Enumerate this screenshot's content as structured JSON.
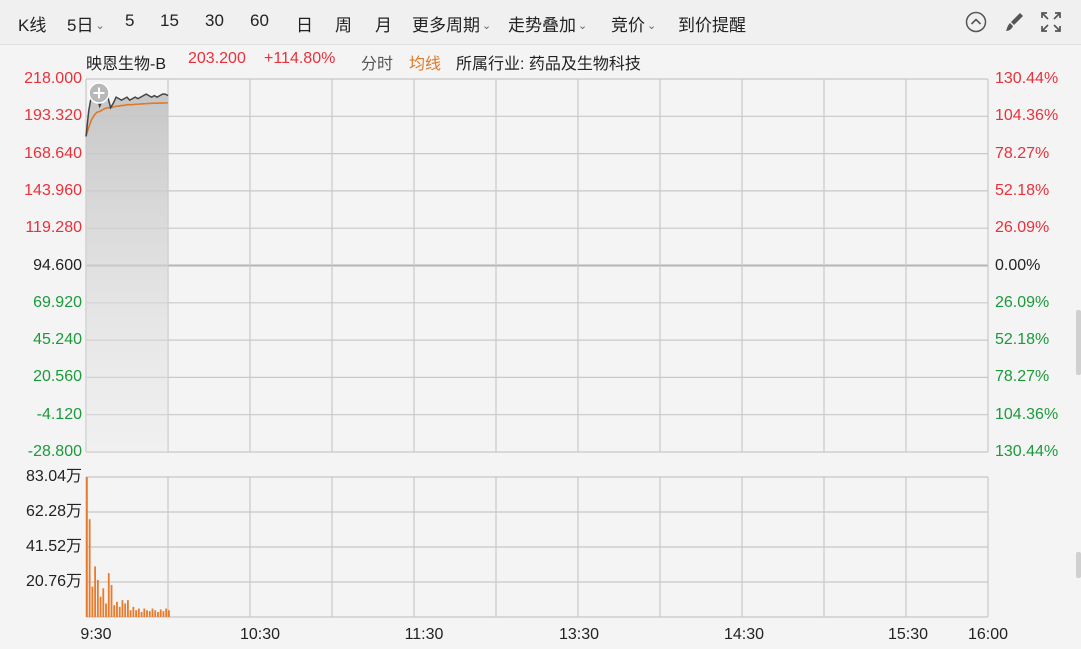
{
  "toolbar": {
    "kline": "K线",
    "days5": "5日",
    "m5": "5",
    "m15": "15",
    "m30": "30",
    "m60": "60",
    "day": "日",
    "week": "周",
    "month": "月",
    "more_periods": "更多周期",
    "trend_overlay": "走势叠加",
    "auction": "竞价",
    "price_alert": "到价提醒",
    "icons": [
      "collapse-up-icon",
      "brush-icon",
      "fullscreen-icon"
    ]
  },
  "stock": {
    "name": "映恩生物-B",
    "price": "203.200",
    "change": "+114.80%",
    "intraday_label": "分时",
    "avg_line_label": "均线",
    "industry": "所属行业: 药品及生物科技"
  },
  "colors": {
    "up": "#e8313a",
    "down": "#1a9a3b",
    "price_line": "#444444",
    "avg_line": "#e07828",
    "volume": "#e87a2a",
    "grid": "#c8c8c8"
  },
  "chart_data": {
    "type": "line",
    "price_axis": {
      "left_labels": [
        "218.000",
        "193.320",
        "168.640",
        "143.960",
        "119.280",
        "94.600",
        "69.920",
        "45.240",
        "20.560",
        "-4.120",
        "-28.800"
      ],
      "right_labels": [
        "130.44%",
        "104.36%",
        "78.27%",
        "52.18%",
        "26.09%",
        "0.00%",
        "26.09%",
        "52.18%",
        "78.27%",
        "104.36%",
        "130.44%"
      ],
      "ylim": [
        -28.8,
        218.0
      ],
      "reference": 94.6
    },
    "volume_axis": {
      "labels": [
        "83.04万",
        "62.28万",
        "41.52万",
        "20.76万"
      ],
      "ylim": [
        0,
        83.04
      ]
    },
    "time_labels": [
      "9:30",
      "10:30",
      "11:30",
      "13:30",
      "14:30",
      "15:30",
      "16:00"
    ],
    "price_series": [
      {
        "t": 0,
        "v": 180
      },
      {
        "t": 1,
        "v": 197
      },
      {
        "t": 2,
        "v": 207
      },
      {
        "t": 3,
        "v": 208
      },
      {
        "t": 4,
        "v": 206
      },
      {
        "t": 5,
        "v": 200
      },
      {
        "t": 6,
        "v": 204
      },
      {
        "t": 7,
        "v": 207
      },
      {
        "t": 8,
        "v": 206
      },
      {
        "t": 9,
        "v": 199
      },
      {
        "t": 10,
        "v": 202
      },
      {
        "t": 11,
        "v": 206
      },
      {
        "t": 12,
        "v": 205
      },
      {
        "t": 13,
        "v": 204
      },
      {
        "t": 14,
        "v": 205
      },
      {
        "t": 15,
        "v": 206
      },
      {
        "t": 16,
        "v": 204
      },
      {
        "t": 17,
        "v": 205
      },
      {
        "t": 18,
        "v": 206
      },
      {
        "t": 19,
        "v": 205
      },
      {
        "t": 20,
        "v": 206
      },
      {
        "t": 21,
        "v": 207
      },
      {
        "t": 22,
        "v": 208
      },
      {
        "t": 23,
        "v": 207
      },
      {
        "t": 24,
        "v": 206
      },
      {
        "t": 25,
        "v": 207
      },
      {
        "t": 26,
        "v": 206
      },
      {
        "t": 27,
        "v": 207
      },
      {
        "t": 28,
        "v": 208
      },
      {
        "t": 29,
        "v": 208
      },
      {
        "t": 30,
        "v": 207
      }
    ],
    "avg_series": [
      {
        "t": 0,
        "v": 180
      },
      {
        "t": 1,
        "v": 186
      },
      {
        "t": 2,
        "v": 191
      },
      {
        "t": 3,
        "v": 194
      },
      {
        "t": 4,
        "v": 196
      },
      {
        "t": 5,
        "v": 196.5
      },
      {
        "t": 6,
        "v": 197.5
      },
      {
        "t": 7,
        "v": 198.5
      },
      {
        "t": 8,
        "v": 199
      },
      {
        "t": 9,
        "v": 199
      },
      {
        "t": 10,
        "v": 199.5
      },
      {
        "t": 11,
        "v": 200
      },
      {
        "t": 12,
        "v": 200
      },
      {
        "t": 13,
        "v": 200.5
      },
      {
        "t": 14,
        "v": 200.5
      },
      {
        "t": 15,
        "v": 201
      },
      {
        "t": 16,
        "v": 201
      },
      {
        "t": 17,
        "v": 201
      },
      {
        "t": 18,
        "v": 201.3
      },
      {
        "t": 19,
        "v": 201.3
      },
      {
        "t": 20,
        "v": 201.5
      },
      {
        "t": 21,
        "v": 201.6
      },
      {
        "t": 22,
        "v": 201.7
      },
      {
        "t": 23,
        "v": 201.8
      },
      {
        "t": 24,
        "v": 201.9
      },
      {
        "t": 25,
        "v": 202
      },
      {
        "t": 26,
        "v": 202
      },
      {
        "t": 27,
        "v": 202.1
      },
      {
        "t": 28,
        "v": 202.1
      },
      {
        "t": 29,
        "v": 202.2
      },
      {
        "t": 30,
        "v": 202.2
      }
    ],
    "volume_series": [
      {
        "t": 0,
        "v": 83.0
      },
      {
        "t": 1,
        "v": 58.0
      },
      {
        "t": 2,
        "v": 18.0
      },
      {
        "t": 3,
        "v": 30.0
      },
      {
        "t": 4,
        "v": 22.0
      },
      {
        "t": 5,
        "v": 12.0
      },
      {
        "t": 6,
        "v": 17.0
      },
      {
        "t": 7,
        "v": 8.0
      },
      {
        "t": 8,
        "v": 26.0
      },
      {
        "t": 9,
        "v": 19.0
      },
      {
        "t": 10,
        "v": 7.0
      },
      {
        "t": 11,
        "v": 9.0
      },
      {
        "t": 12,
        "v": 6.0
      },
      {
        "t": 13,
        "v": 10.0
      },
      {
        "t": 14,
        "v": 8.0
      },
      {
        "t": 15,
        "v": 10.0
      },
      {
        "t": 16,
        "v": 4.0
      },
      {
        "t": 17,
        "v": 6.0
      },
      {
        "t": 18,
        "v": 4.0
      },
      {
        "t": 19,
        "v": 5.0
      },
      {
        "t": 20,
        "v": 3.0
      },
      {
        "t": 21,
        "v": 5.0
      },
      {
        "t": 22,
        "v": 4.0
      },
      {
        "t": 23,
        "v": 3.5
      },
      {
        "t": 24,
        "v": 5.0
      },
      {
        "t": 25,
        "v": 4.0
      },
      {
        "t": 26,
        "v": 3.0
      },
      {
        "t": 27,
        "v": 4.5
      },
      {
        "t": 28,
        "v": 3.5
      },
      {
        "t": 29,
        "v": 5.0
      },
      {
        "t": 30,
        "v": 4.0
      }
    ],
    "session_minutes": 330
  }
}
